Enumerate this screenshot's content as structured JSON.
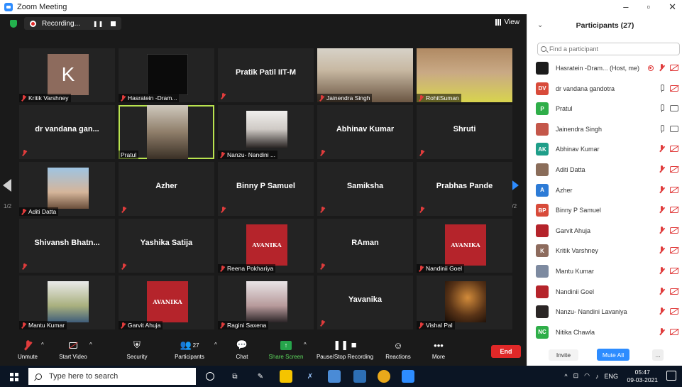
{
  "window": {
    "title": "Zoom Meeting",
    "controls": [
      "–",
      "▫",
      "✕"
    ]
  },
  "topbar": {
    "recording_label": "Recording...",
    "view_label": "View"
  },
  "tiles": [
    {
      "name": "Kritik Varshney",
      "kind": "avatar",
      "letter": "K"
    },
    {
      "name": "Hasratein -Dram...",
      "kind": "image"
    },
    {
      "name": "",
      "center": "Pratik Patil IIT-M",
      "kind": "text"
    },
    {
      "name": "Jainendra Singh",
      "kind": "video"
    },
    {
      "name": "RohitSuman",
      "kind": "video"
    },
    {
      "name": "",
      "center": "dr vandana gan...",
      "kind": "text"
    },
    {
      "name": "Pratul",
      "kind": "video"
    },
    {
      "name": "Nanzu- Nandini ...",
      "kind": "image"
    },
    {
      "name": "",
      "center": "Abhinav Kumar",
      "kind": "text"
    },
    {
      "name": "",
      "center": "Shruti",
      "kind": "text"
    },
    {
      "name": "Aditi Datta",
      "kind": "image"
    },
    {
      "name": "",
      "center": "Azher",
      "kind": "text"
    },
    {
      "name": "",
      "center": "Binny P Samuel",
      "kind": "text"
    },
    {
      "name": "",
      "center": "Samiksha",
      "kind": "text"
    },
    {
      "name": "",
      "center": "Prabhas Pande",
      "kind": "text"
    },
    {
      "name": "",
      "center": "Shivansh  Bhatn...",
      "kind": "text"
    },
    {
      "name": "",
      "center": "Yashika Satija",
      "kind": "text"
    },
    {
      "name": "Reena Pokhariya",
      "kind": "avanika"
    },
    {
      "name": "",
      "center": "RAman",
      "kind": "text"
    },
    {
      "name": "Nandinii Goel",
      "kind": "avanika"
    },
    {
      "name": "Mantu Kumar",
      "kind": "image"
    },
    {
      "name": "Garvit Ahuja",
      "kind": "avanika"
    },
    {
      "name": "Ragini Saxena",
      "kind": "image"
    },
    {
      "name": "",
      "center": "Yavanika",
      "kind": "text"
    },
    {
      "name": "Vishal Pal",
      "kind": "image"
    }
  ],
  "avanika_text": "AVANIKA",
  "pager": {
    "left": "1/2",
    "right": "1/2"
  },
  "toolbar": {
    "unmute": "Unmute",
    "start_video": "Start Video",
    "security": "Security",
    "participants": "Participants",
    "participants_count": "27",
    "chat": "Chat",
    "share_screen": "Share Screen",
    "pause_recording": "Pause/Stop Recording",
    "reactions": "Reactions",
    "more": "More",
    "end": "End"
  },
  "panel": {
    "title": "Participants (27)",
    "search_placeholder": "Find a participant",
    "participants": [
      {
        "name": "Hasratein -Dram... (Host, me)",
        "initials": "",
        "color": "#1b1b1b",
        "mic": "red",
        "cam": "red",
        "rec": true
      },
      {
        "name": "dr vandana gandotra",
        "initials": "DV",
        "color": "#d84b3a",
        "mic": "gray",
        "cam": "red"
      },
      {
        "name": "Pratul",
        "initials": "P",
        "color": "#2fae49",
        "mic": "gray",
        "cam": "gray"
      },
      {
        "name": "Jainendra Singh",
        "initials": "",
        "color": "#c4574a",
        "mic": "gray",
        "cam": "gray"
      },
      {
        "name": "Abhinav Kumar",
        "initials": "AK",
        "color": "#1f9e89",
        "mic": "red",
        "cam": "red"
      },
      {
        "name": "Aditi Datta",
        "initials": "",
        "color": "#8a6d5a",
        "mic": "red",
        "cam": "red"
      },
      {
        "name": "Azher",
        "initials": "A",
        "color": "#2d7bd6",
        "mic": "red",
        "cam": "red"
      },
      {
        "name": "Binny P Samuel",
        "initials": "BP",
        "color": "#d84b3a",
        "mic": "red",
        "cam": "red"
      },
      {
        "name": "Garvit Ahuja",
        "initials": "",
        "color": "#b5242b",
        "mic": "red",
        "cam": "red"
      },
      {
        "name": "Kritik Varshney",
        "initials": "K",
        "color": "#8d6b5d",
        "mic": "red",
        "cam": "red"
      },
      {
        "name": "Mantu Kumar",
        "initials": "",
        "color": "#7d8aa0",
        "mic": "red",
        "cam": "red"
      },
      {
        "name": "Nandinii Goel",
        "initials": "",
        "color": "#b5242b",
        "mic": "red",
        "cam": "red"
      },
      {
        "name": "Nanzu- Nandini Lavaniya",
        "initials": "",
        "color": "#2b2625",
        "mic": "red",
        "cam": "red"
      },
      {
        "name": "Nitika Chawla",
        "initials": "NC",
        "color": "#2fae49",
        "mic": "red",
        "cam": "red"
      }
    ],
    "invite": "Invite",
    "mute_all": "Mute All",
    "more": "..."
  },
  "taskbar": {
    "search_placeholder": "Type here to search",
    "lang": "ENG",
    "time": "05:47",
    "date": "09-03-2021"
  }
}
